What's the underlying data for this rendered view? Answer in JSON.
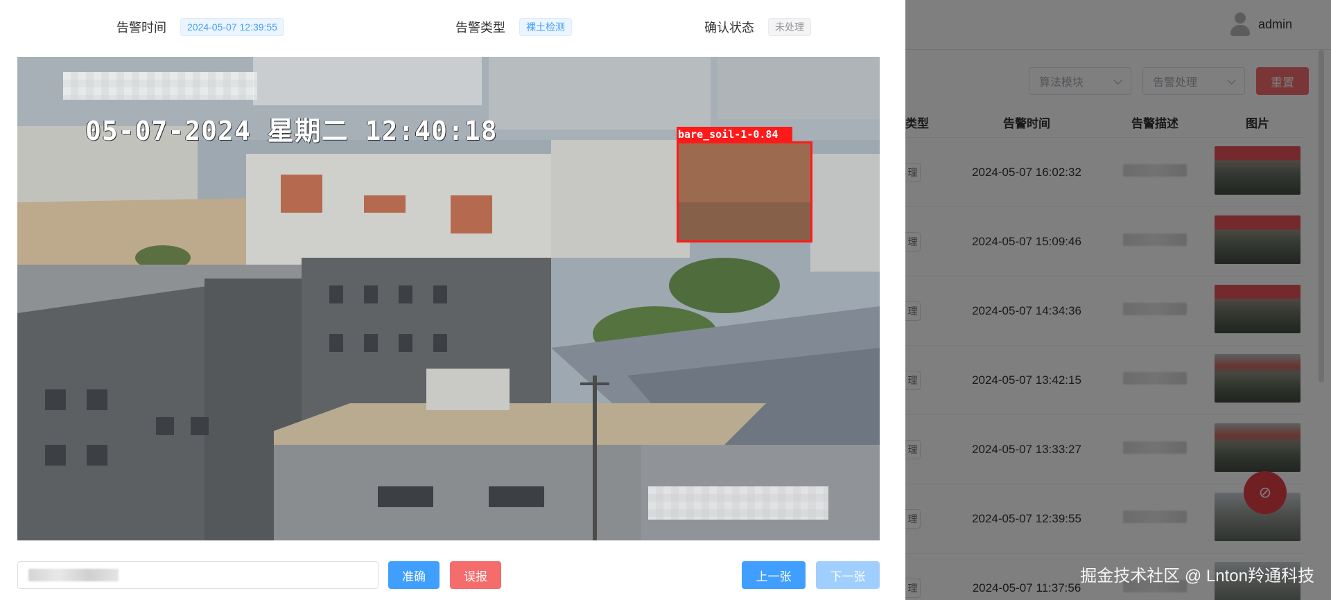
{
  "background_page": {
    "user": {
      "name": "admin"
    },
    "filters": {
      "algorithm_placeholder": "算法模块",
      "handling_placeholder": "告警处理",
      "reset_label": "重置"
    },
    "table": {
      "headers": {
        "type": "类型",
        "time": "告警时间",
        "desc": "告警描述",
        "image": "图片"
      },
      "rows": [
        {
          "tag": "理",
          "time": "2024-05-07 16:02:32",
          "thumb": "red"
        },
        {
          "tag": "理",
          "time": "2024-05-07 15:09:46",
          "thumb": "red"
        },
        {
          "tag": "理",
          "time": "2024-05-07 14:34:36",
          "thumb": "red"
        },
        {
          "tag": "理",
          "time": "2024-05-07 13:42:15",
          "thumb": "gray"
        },
        {
          "tag": "理",
          "time": "2024-05-07 13:33:27",
          "thumb": "gray"
        },
        {
          "tag": "理",
          "time": "2024-05-07 12:39:55",
          "thumb": "plain"
        },
        {
          "tag": "理",
          "time": "2024-05-07 11:37:56",
          "thumb": "plain"
        }
      ]
    },
    "watermark": "掘金技术社区 @ Lnton羚通科技"
  },
  "drawer": {
    "alarm_time_label": "告警时间",
    "alarm_time_value": "2024-05-07 12:39:55",
    "alarm_type_label": "告警类型",
    "alarm_type_value": "裸土检测",
    "confirm_status_label": "确认状态",
    "confirm_status_value": "未处理",
    "camera_overlay_time": "05-07-2024 星期二 12:40:18",
    "detection_label": "bare_soil-1-0.84",
    "buttons": {
      "accurate": "准确",
      "false_alarm": "误报",
      "prev": "上一张",
      "next": "下一张"
    }
  },
  "colors": {
    "primary": "#409eff",
    "danger": "#f56c6c",
    "detection_box": "#ff1a1a"
  }
}
